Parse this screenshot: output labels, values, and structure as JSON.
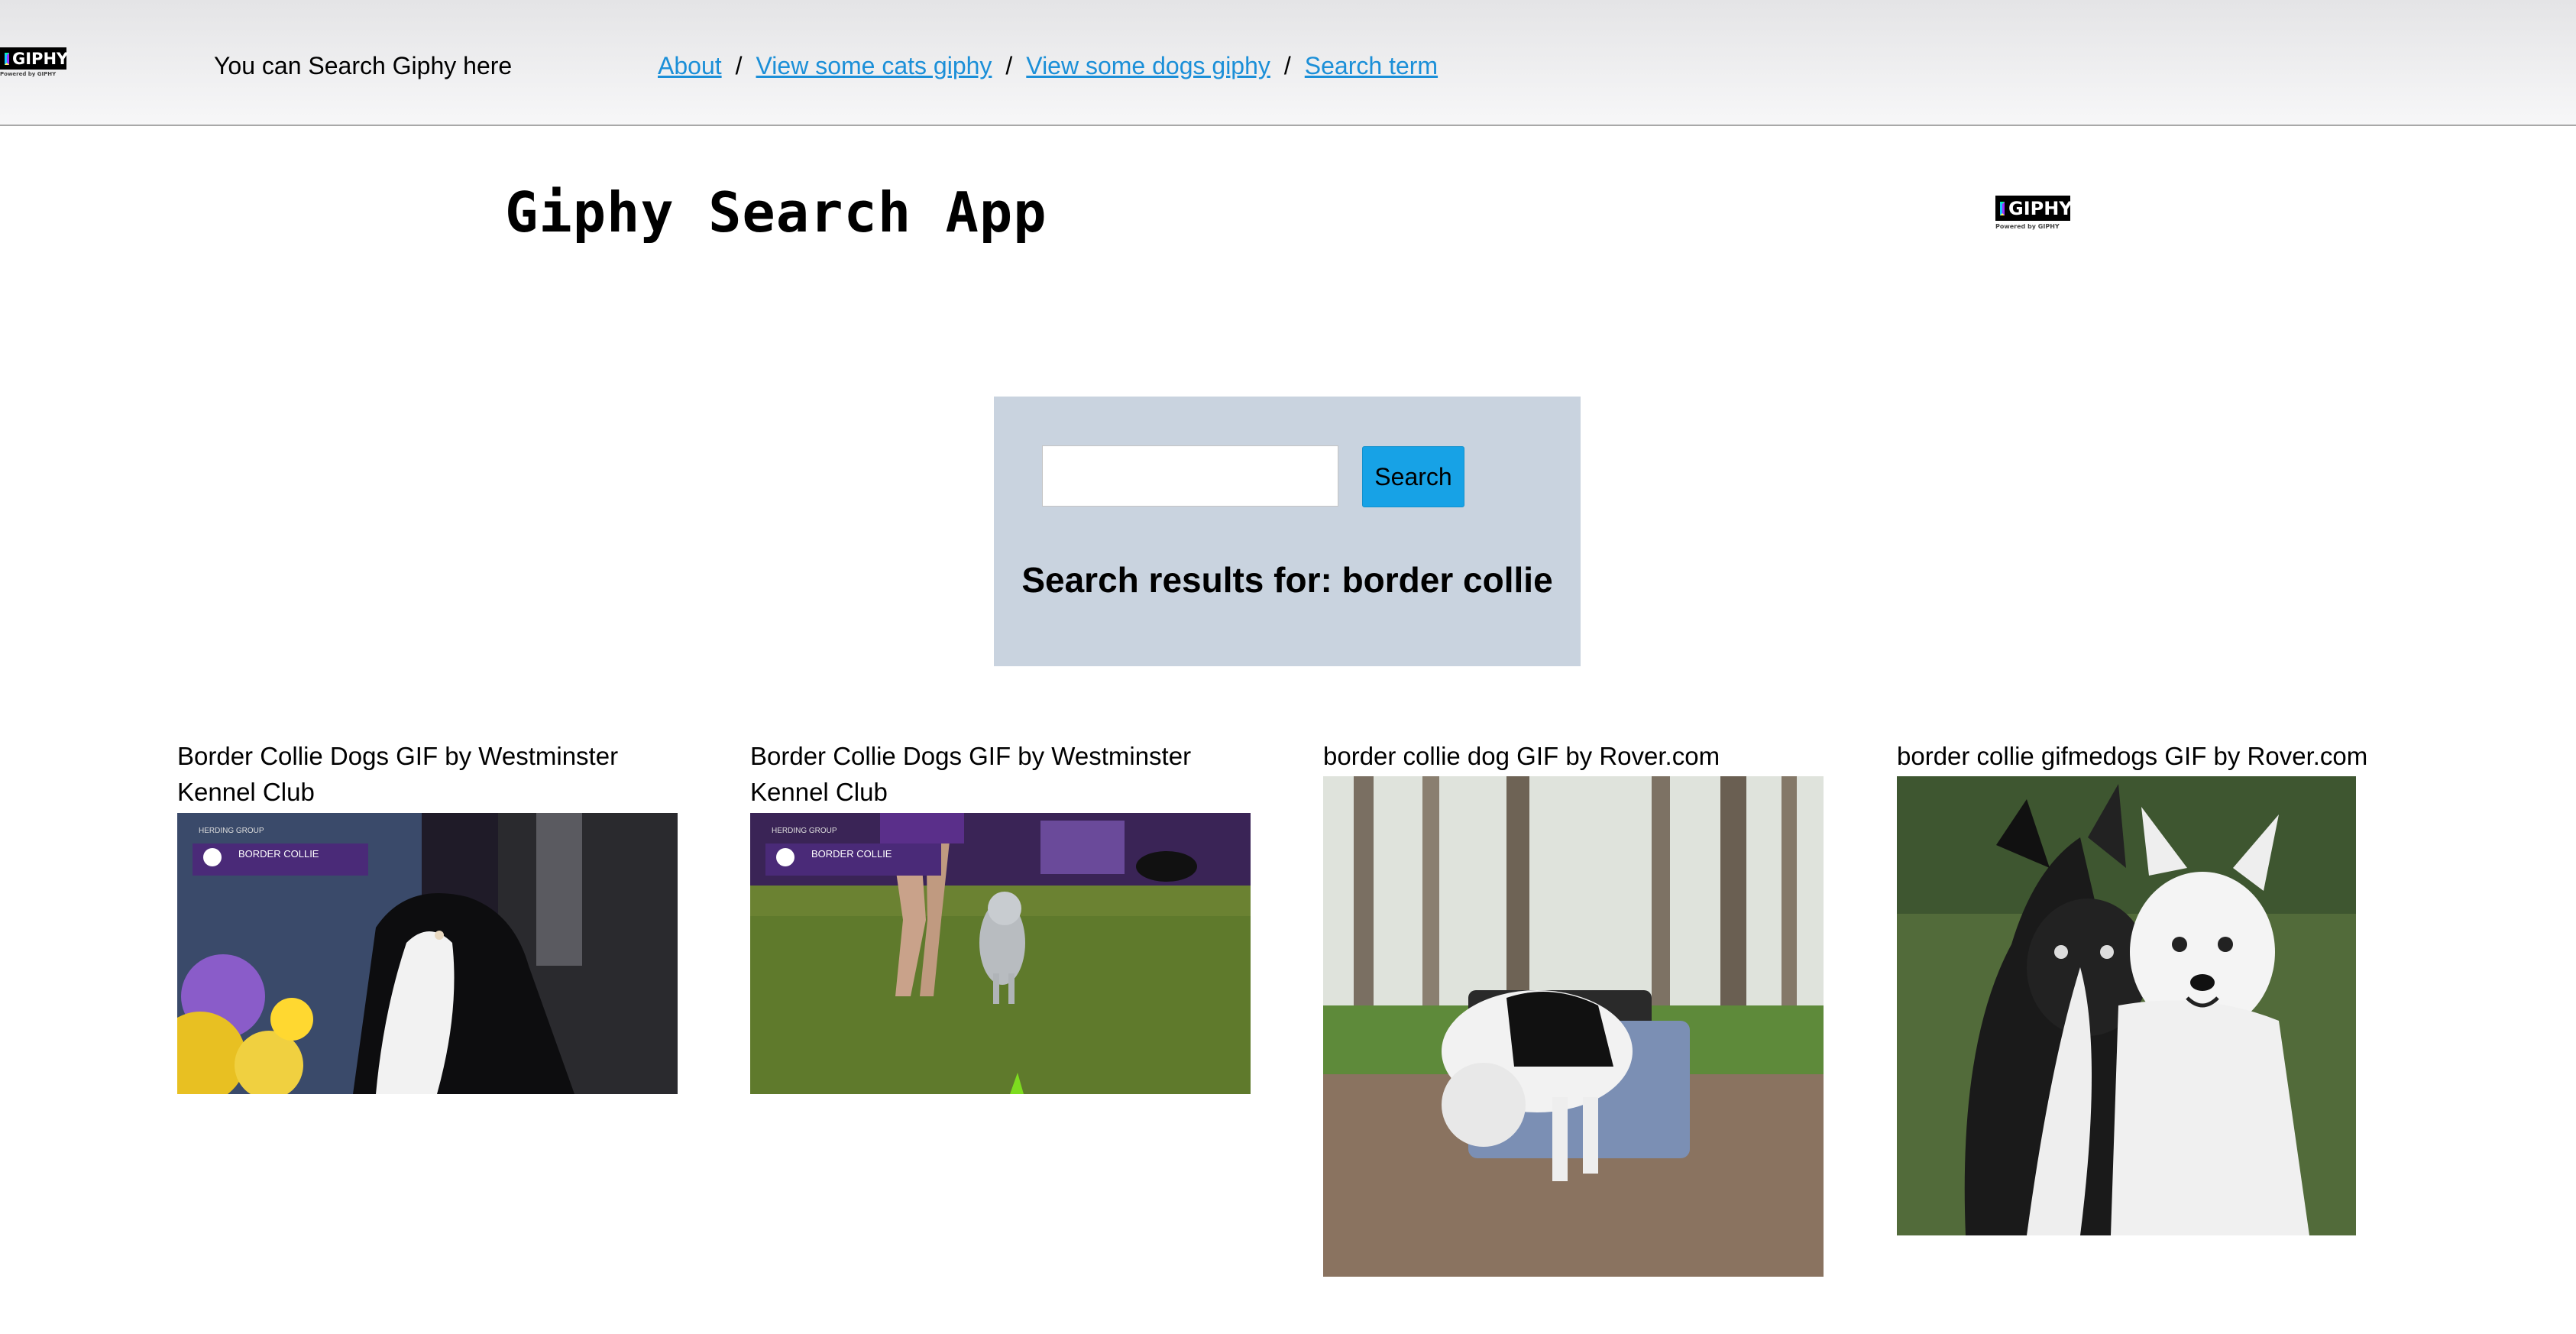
{
  "header": {
    "logo_text": "GIPHY",
    "logo_subtext": "Powered by GIPHY",
    "tagline": "You can Search Giphy here",
    "nav": {
      "about": "About",
      "cats": "View some cats giphy",
      "dogs": "View some dogs giphy",
      "search_term": "Search term",
      "separator": "/"
    }
  },
  "main": {
    "title": "Giphy Search App",
    "logo_text": "GIPHY",
    "logo_subtext": "Powered by GIPHY"
  },
  "search": {
    "input_value": "",
    "button_label": "Search",
    "results_heading": "Search results for: border collie"
  },
  "results": [
    {
      "title": "Border Collie Dogs GIF by Westminster Kennel Club",
      "badge_group": "HERDING GROUP",
      "badge_breed": "BORDER COLLIE"
    },
    {
      "title": "Border Collie Dogs GIF by Westminster Kennel Club",
      "badge_group": "HERDING GROUP",
      "badge_breed": "BORDER COLLIE"
    },
    {
      "title": "border collie dog GIF by Rover.com"
    },
    {
      "title": "border collie gifmedogs GIF by Rover.com"
    }
  ],
  "colors": {
    "link": "#1b8fd8",
    "search_button": "#17a2e6",
    "search_panel": "#c9d3df"
  }
}
